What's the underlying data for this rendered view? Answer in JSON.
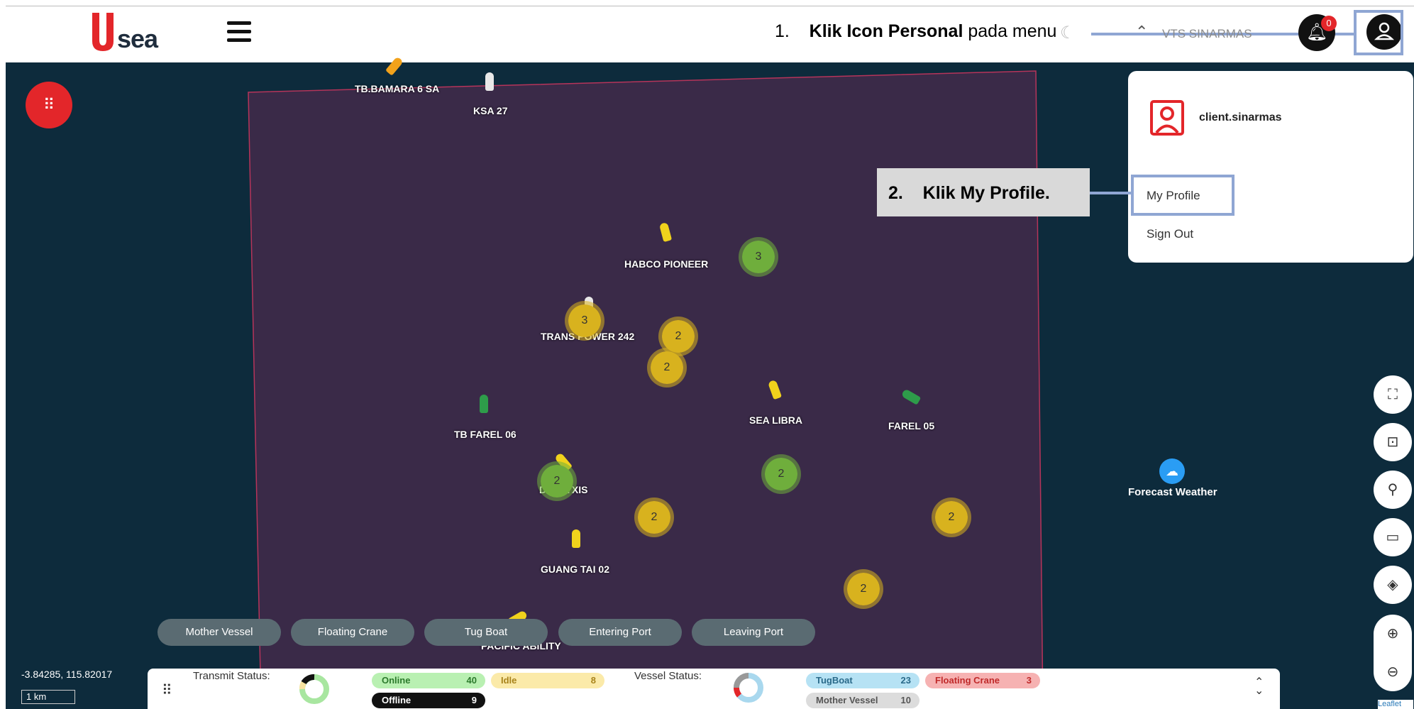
{
  "header": {
    "logo_text": "sea",
    "step1_number": "1.",
    "step1_bold": "Klik Icon Personal",
    "step1_rest": " pada menu",
    "vts_label": "VTS SINARMAS",
    "notification_count": "0"
  },
  "user_menu": {
    "username": "client.sinarmas",
    "my_profile": "My Profile",
    "sign_out": "Sign Out"
  },
  "step2": {
    "number": "2.",
    "text": "Klik My Profile."
  },
  "vessels": [
    {
      "name": "TB.BAMARA 6 SA"
    },
    {
      "name": "KSA 27"
    },
    {
      "name": "HABCO PIONEER"
    },
    {
      "name": "TRANS POWER 242"
    },
    {
      "name": "TB FAREL 06"
    },
    {
      "name": "SEA LIBRA"
    },
    {
      "name": "FAREL 05"
    },
    {
      "name": "DSI PYXIS"
    },
    {
      "name": "GUANG TAI 02"
    },
    {
      "name": "PACIFIC ABILITY"
    }
  ],
  "clusters": [
    "3",
    "3",
    "2",
    "2",
    "2",
    "2",
    "2",
    "2",
    "2"
  ],
  "weather": {
    "label": "Forecast Weather"
  },
  "filters": [
    "Mother Vessel",
    "Floating Crane",
    "Tug Boat",
    "Entering Port",
    "Leaving Port"
  ],
  "status_bar": {
    "transmit_label": "Transmit Status:",
    "vessel_label": "Vessel Status:",
    "online": {
      "label": "Online",
      "count": "40"
    },
    "idle": {
      "label": "Idle",
      "count": "8"
    },
    "offline": {
      "label": "Offline",
      "count": "9"
    },
    "tugboat": {
      "label": "TugBoat",
      "count": "23"
    },
    "floating_crane": {
      "label": "Floating Crane",
      "count": "3"
    },
    "mother_vessel": {
      "label": "Mother Vessel",
      "count": "10"
    }
  },
  "map_info": {
    "coordinates": "-3.84285, 115.82017",
    "scale": "1 km",
    "attribution": "Leaflet"
  },
  "colors": {
    "brand_red": "#e3262a",
    "highlight_blue": "#8fa6d3",
    "sea": "#0d2b3c",
    "zone_fill": "#3a2a48"
  }
}
